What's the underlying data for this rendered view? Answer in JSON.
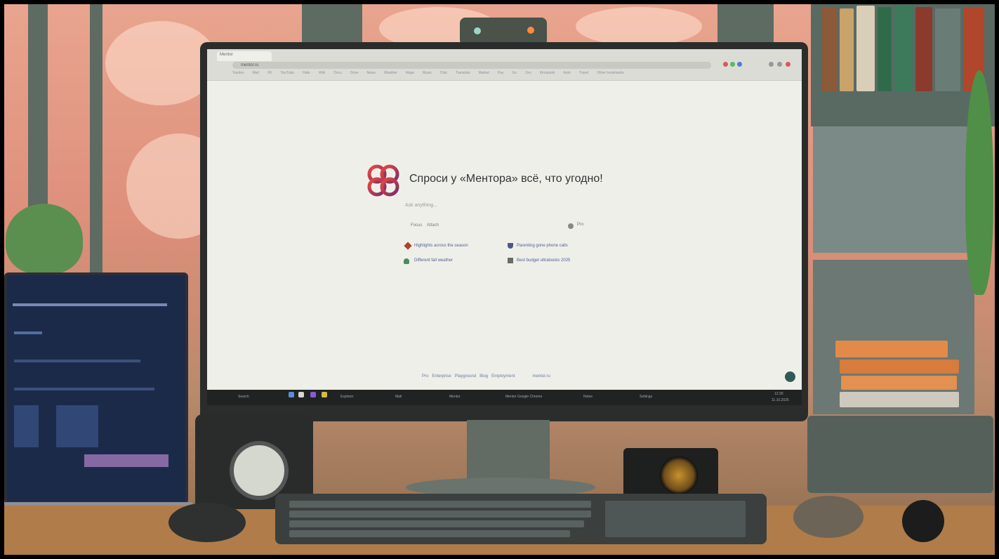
{
  "browser": {
    "tab_title": "Mentor",
    "address": "mentor.ru",
    "bookmarks": [
      "Yandex",
      "Mail",
      "VK",
      "YouTube",
      "Habr",
      "Wiki",
      "Docs",
      "Drive",
      "News",
      "Weather",
      "Maps",
      "Music",
      "Disk",
      "Translate",
      "Market",
      "Pay",
      "Go",
      "Zen",
      "Kinopoisk",
      "Auto",
      "Travel",
      "Other bookmarks"
    ]
  },
  "hero": {
    "title": "Спроси у «Ментора» всё, что угодно!",
    "ask_placeholder": "Ask anything...",
    "focus_label": "Focus",
    "attach_label": "Attach",
    "pro_label": "Pro"
  },
  "suggestions": [
    {
      "label": "Highlights across the season",
      "icon": "pencil-icon",
      "color": "#b0412e"
    },
    {
      "label": "Parenting gone phone calls",
      "icon": "shield-icon",
      "color": "#4c5a82"
    },
    {
      "label": "Different fall weather",
      "icon": "cloud-icon",
      "color": "#4d8a5e"
    },
    {
      "label": "Best budget ultrabooks 2025",
      "icon": "laptop-icon",
      "color": "#6b6b6b"
    }
  ],
  "footer": {
    "links": [
      "Pro",
      "Enterprise",
      "Playground",
      "Blog",
      "Employment",
      "mentor.ru"
    ]
  },
  "taskbar": {
    "search": "Search",
    "items": [
      "Mentor",
      "Explorer",
      "Mail",
      "Mentor Google Chrome",
      "Notes",
      "Settings"
    ],
    "time": "12:30",
    "date": "11.10.2025"
  },
  "colors": {
    "accent": "#2f5a58",
    "link": "#4f5f90",
    "logo_start": "#e8493e",
    "logo_end": "#7a2d6a"
  }
}
